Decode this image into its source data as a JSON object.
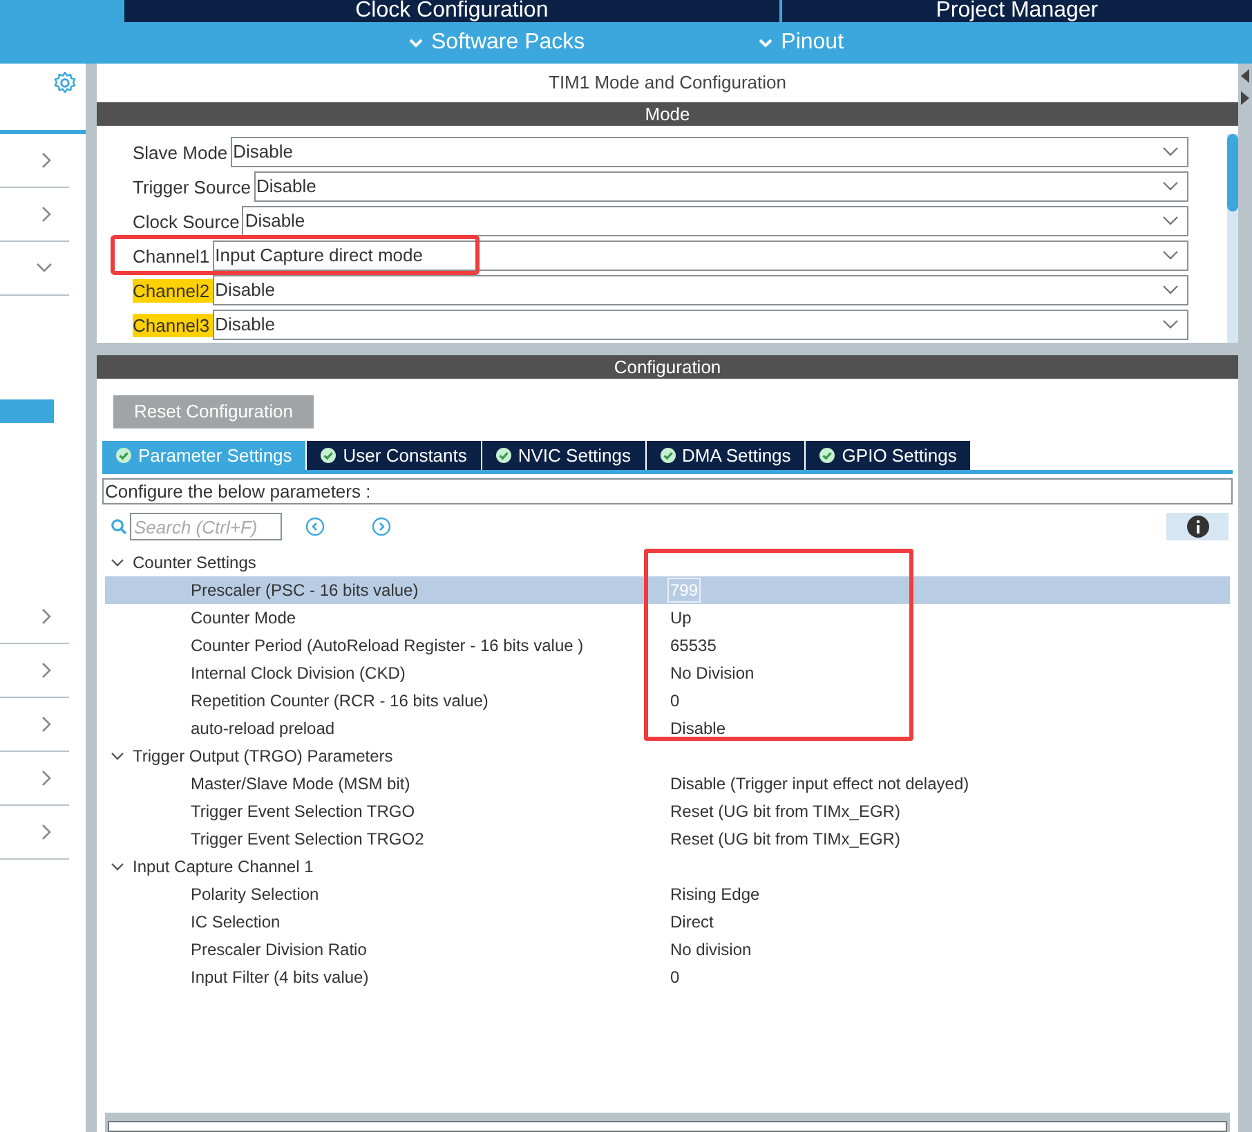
{
  "top_tabs": [
    {
      "label": "Clock Configuration"
    },
    {
      "label": "Project Manager"
    }
  ],
  "menus": [
    {
      "label": "Software Packs"
    },
    {
      "label": "Pinout"
    }
  ],
  "sidebar": {
    "items": [
      {
        "kind": "category",
        "expanded": false
      },
      {
        "kind": "category",
        "expanded": false
      },
      {
        "kind": "category",
        "expanded": true
      },
      {
        "kind": "entry",
        "selected": true
      },
      {
        "kind": "category",
        "expanded": false
      },
      {
        "kind": "category",
        "expanded": false
      },
      {
        "kind": "category",
        "expanded": false
      },
      {
        "kind": "category",
        "expanded": false
      },
      {
        "kind": "category",
        "expanded": false
      }
    ]
  },
  "panel_title": "TIM1 Mode and Configuration",
  "mode": {
    "title": "Mode",
    "rows": [
      {
        "label": "Slave Mode",
        "value": "Disable",
        "highlighted": false,
        "boxed": false
      },
      {
        "label": "Trigger Source",
        "value": "Disable",
        "highlighted": false,
        "boxed": false
      },
      {
        "label": "Clock Source",
        "value": "Disable",
        "highlighted": false,
        "boxed": false
      },
      {
        "label": "Channel1",
        "value": "Input Capture direct mode",
        "highlighted": false,
        "boxed": true
      },
      {
        "label": "Channel2",
        "value": "Disable",
        "highlighted": true,
        "boxed": false
      },
      {
        "label": "Channel3",
        "value": "Disable",
        "highlighted": true,
        "boxed": false
      }
    ]
  },
  "configuration": {
    "title": "Configuration",
    "reset_button": "Reset Configuration",
    "tabs": [
      {
        "label": "Parameter Settings",
        "selected": true
      },
      {
        "label": "User Constants",
        "selected": false
      },
      {
        "label": "NVIC Settings",
        "selected": false
      },
      {
        "label": "DMA Settings",
        "selected": false
      },
      {
        "label": "GPIO Settings",
        "selected": false
      }
    ],
    "hint": "Configure the below parameters :",
    "search": {
      "placeholder": "Search (Ctrl+F)"
    },
    "groups": [
      {
        "label": "Counter Settings",
        "expanded": true,
        "boxed": true,
        "children": [
          {
            "name": "Prescaler (PSC - 16 bits value)",
            "value": "799",
            "selected": true
          },
          {
            "name": "Counter Mode",
            "value": "Up",
            "selected": false
          },
          {
            "name": "Counter Period (AutoReload Register - 16 bits value )",
            "value": "65535",
            "selected": false
          },
          {
            "name": "Internal Clock Division (CKD)",
            "value": "No Division",
            "selected": false
          },
          {
            "name": "Repetition Counter (RCR - 16 bits value)",
            "value": "0",
            "selected": false
          },
          {
            "name": "auto-reload preload",
            "value": "Disable",
            "selected": false
          }
        ]
      },
      {
        "label": "Trigger Output (TRGO) Parameters",
        "expanded": true,
        "boxed": false,
        "children": [
          {
            "name": "Master/Slave Mode (MSM bit)",
            "value": "Disable (Trigger input effect not delayed)",
            "selected": false
          },
          {
            "name": "Trigger Event Selection TRGO",
            "value": "Reset (UG bit from TIMx_EGR)",
            "selected": false
          },
          {
            "name": "Trigger Event Selection TRGO2",
            "value": "Reset (UG bit from TIMx_EGR)",
            "selected": false
          }
        ]
      },
      {
        "label": "Input Capture Channel 1",
        "expanded": true,
        "boxed": false,
        "children": [
          {
            "name": "Polarity Selection",
            "value": "Rising Edge",
            "selected": false
          },
          {
            "name": "IC Selection",
            "value": "Direct",
            "selected": false
          },
          {
            "name": "Prescaler Division Ratio",
            "value": "No division",
            "selected": false
          },
          {
            "name": "Input Filter (4 bits value)",
            "value": "0",
            "selected": false
          }
        ]
      }
    ]
  }
}
